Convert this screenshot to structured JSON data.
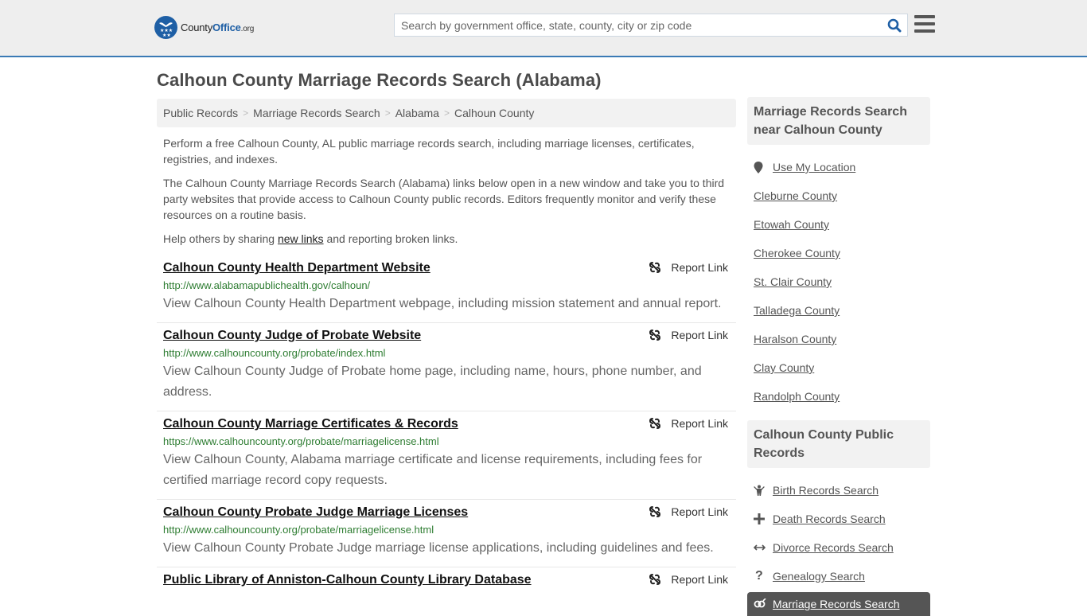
{
  "header": {
    "logo": {
      "brand_prefix": "County",
      "brand_main": "Office",
      "brand_suffix": ".org"
    },
    "search": {
      "placeholder": "Search by government office, state, county, city or zip code",
      "value": ""
    },
    "icons": {
      "search": "search-icon",
      "menu": "hamburger-menu-icon"
    }
  },
  "page": {
    "title": "Calhoun County Marriage Records Search (Alabama)"
  },
  "breadcrumb": [
    {
      "label": "Public Records"
    },
    {
      "label": "Marriage Records Search"
    },
    {
      "label": "Alabama"
    },
    {
      "label": "Calhoun County"
    }
  ],
  "intro": {
    "p1": "Perform a free Calhoun County, AL public marriage records search, including marriage licenses, certificates, registries, and indexes.",
    "p2": "The Calhoun County Marriage Records Search (Alabama) links below open in a new window and take you to third party websites that provide access to Calhoun County public records. Editors frequently monitor and verify these resources on a routine basis.",
    "p3_before": "Help others by sharing ",
    "p3_link": "new links",
    "p3_after": " and reporting broken links."
  },
  "results": [
    {
      "title": "Calhoun County Health Department Website",
      "url": "http://www.alabamapublichealth.gov/calhoun/",
      "description": "View Calhoun County Health Department webpage, including mission statement and annual report.",
      "report_label": "Report Link"
    },
    {
      "title": "Calhoun County Judge of Probate Website",
      "url": "http://www.calhouncounty.org/probate/index.html",
      "description": "View Calhoun County Judge of Probate home page, including name, hours, phone number, and address.",
      "report_label": "Report Link"
    },
    {
      "title": "Calhoun County Marriage Certificates & Records",
      "url": "https://www.calhouncounty.org/probate/marriagelicense.html",
      "description": "View Calhoun County, Alabama marriage certificate and license requirements, including fees for certified marriage record copy requests.",
      "report_label": "Report Link"
    },
    {
      "title": "Calhoun County Probate Judge Marriage Licenses",
      "url": "http://www.calhouncounty.org/probate/marriagelicense.html",
      "description": "View Calhoun County Probate Judge marriage license applications, including guidelines and fees.",
      "report_label": "Report Link"
    },
    {
      "title": "Public Library of Anniston-Calhoun County Library Database",
      "url": "",
      "description": "",
      "report_label": "Report Link"
    }
  ],
  "sidebar": {
    "nearby": {
      "heading": "Marriage Records Search near Calhoun County",
      "use_location": "Use My Location",
      "counties": [
        "Cleburne County",
        "Etowah County",
        "Cherokee County",
        "St. Clair County",
        "Talladega County",
        "Haralson County",
        "Clay County",
        "Randolph County"
      ]
    },
    "public_records": {
      "heading": "Calhoun County Public Records",
      "items": [
        {
          "label": "Birth Records Search",
          "icon": "child-icon"
        },
        {
          "label": "Death Records Search",
          "icon": "plus-icon"
        },
        {
          "label": "Divorce Records Search",
          "icon": "arrows-horizontal-icon"
        },
        {
          "label": "Genealogy Search",
          "icon": "question-icon"
        }
      ],
      "active": {
        "label": "Marriage Records Search",
        "icon": "marriage-icon"
      }
    }
  },
  "colors": {
    "brand_blue": "#1e5fa5",
    "header_border": "#3a7ab5",
    "url_green": "#2e7d32",
    "active_bg": "#555555"
  }
}
